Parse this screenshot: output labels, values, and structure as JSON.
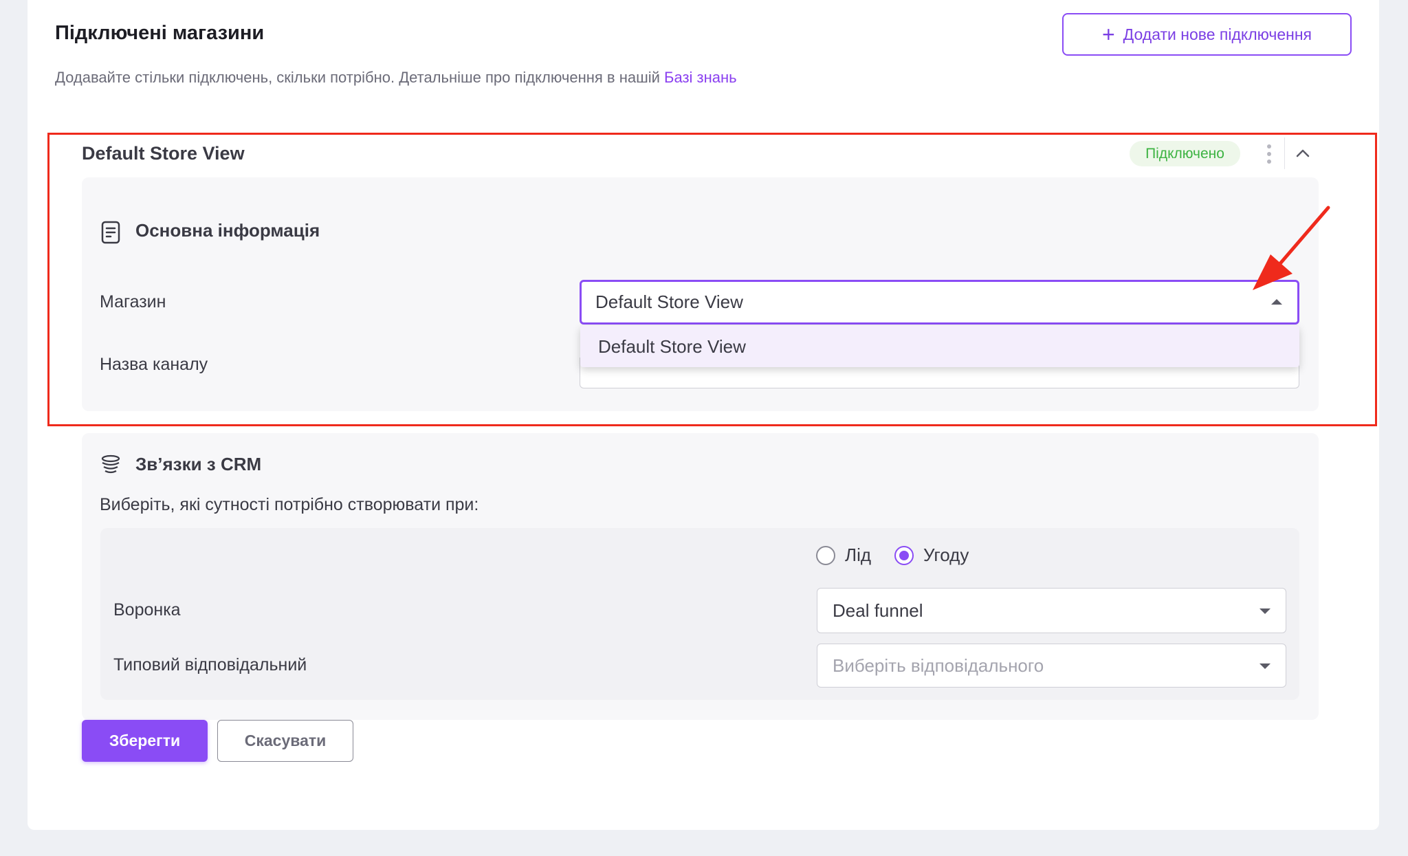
{
  "header": {
    "title": "Підключені магазини",
    "subtitle": "Додавайте стільки підключень, скільки потрібно. Детальніше про підключення в нашій",
    "kb_link": "Базі знань",
    "add_button": "Додати нове підключення"
  },
  "store": {
    "title": "Default Store View",
    "status": "Підключено"
  },
  "basic_info": {
    "title": "Основна інформація",
    "store_label": "Магазин",
    "store_value": "Default Store View",
    "dropdown_options": [
      "Default Store View"
    ],
    "channel_label": "Назва каналу"
  },
  "crm": {
    "title": "Зв’язки з CRM",
    "prompt": "Виберіть, які сутності потрібно створювати при:",
    "radio_options": [
      "Лід",
      "Угоду"
    ],
    "radio_selected": "Угоду",
    "funnel_label": "Воронка",
    "funnel_value": "Deal funnel",
    "responsible_label": "Типовий відповідальний",
    "responsible_placeholder": "Виберіть відповідального"
  },
  "actions": {
    "save": "Зберегти",
    "cancel": "Скасувати"
  },
  "colors": {
    "accent": "#8a4cf5",
    "status_green": "#3db342",
    "annotation_red": "#ef2a1c"
  }
}
